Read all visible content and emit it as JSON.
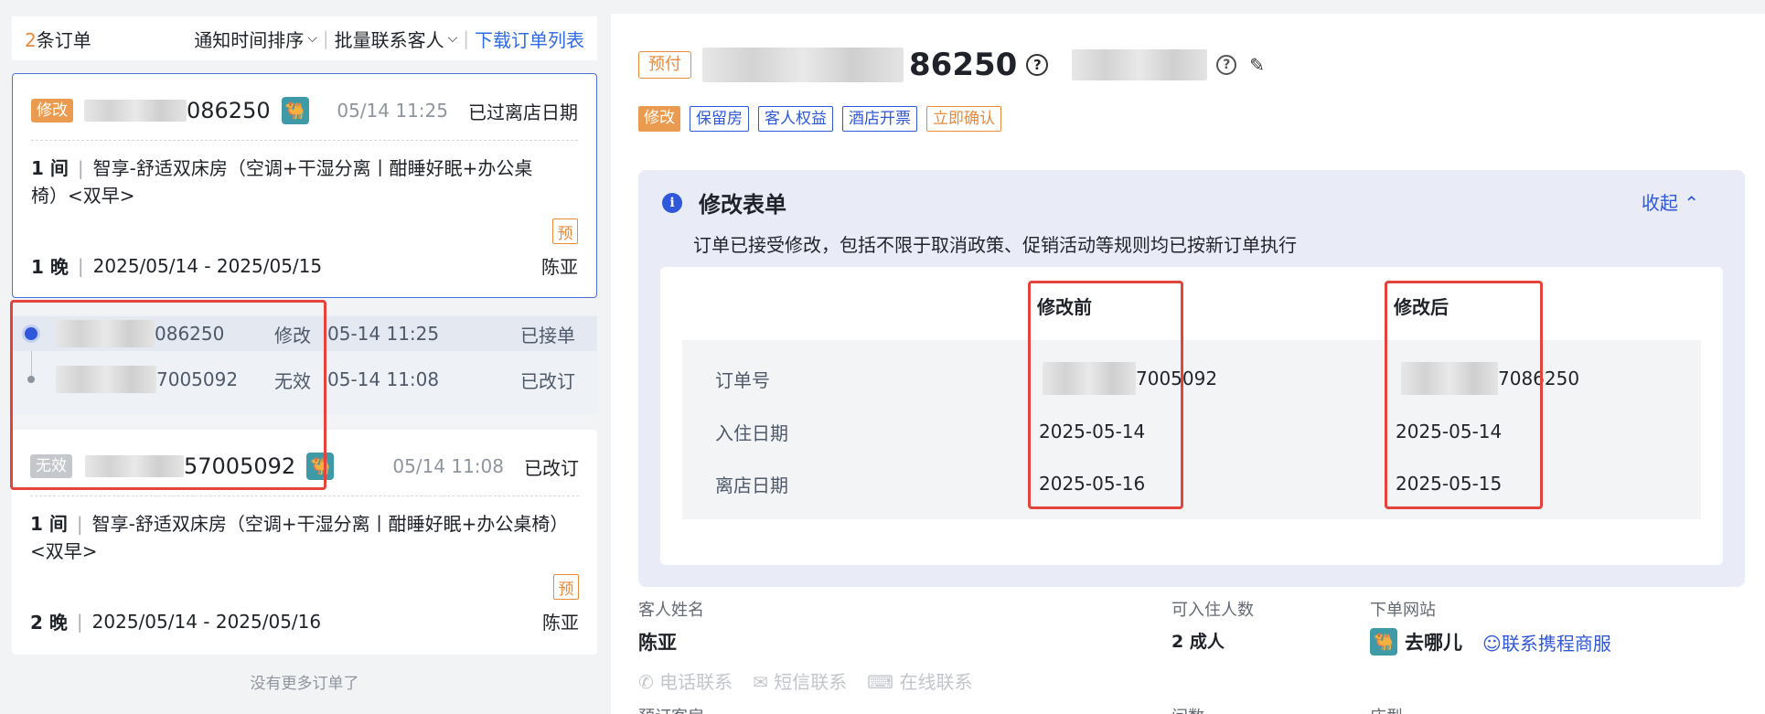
{
  "left": {
    "count_num": "2",
    "count_suffix": "条订单",
    "sort_label": "通知时间排序",
    "batch_label": "批量联系客人",
    "download_label": "下载订单列表",
    "no_more": "没有更多订单了"
  },
  "orders": [
    {
      "tag": "修改",
      "order_no_suffix": "086250",
      "time": "05/14 11:25",
      "status": "已过离店日期",
      "room_count": "1 间",
      "room_name": "智享-舒适双床房（空调+干湿分离丨酣睡好眠+办公桌椅）<双早>",
      "prepay_badge": "预",
      "nights": "1 晚",
      "dates": "2025/05/14 - 2025/05/15",
      "guest": "陈亚"
    },
    {
      "tag": "无效",
      "order_no_suffix": "57005092",
      "time": "05/14 11:08",
      "status": "已改订",
      "room_count": "1 间",
      "room_name": "智享-舒适双床房（空调+干湿分离丨酣睡好眠+办公桌椅）<双早>",
      "prepay_badge": "预",
      "nights": "2 晚",
      "dates": "2025/05/14 - 2025/05/16",
      "guest": "陈亚"
    }
  ],
  "history": [
    {
      "no_suffix": "086250",
      "kind": "修改",
      "time": "05-14 11:25",
      "status": "已接单"
    },
    {
      "no_suffix": "7005092",
      "kind": "无效",
      "time": "05-14 11:08",
      "status": "已改订"
    }
  ],
  "detail": {
    "prepay_tag": "预付",
    "order_no_suffix": "86250",
    "tags": [
      "修改",
      "保留房",
      "客人权益",
      "酒店开票",
      "立即确认"
    ],
    "modify": {
      "title": "修改表单",
      "collapse_label": "收起",
      "desc": "订单已接受修改，包括不限于取消政策、促销活动等规则均已按新订单执行",
      "col_before": "修改前",
      "col_after": "修改后",
      "rows": [
        {
          "label": "订单号",
          "before": "7005092",
          "after": "7086250"
        },
        {
          "label": "入住日期",
          "before": "2025-05-14",
          "after": "2025-05-14"
        },
        {
          "label": "离店日期",
          "before": "2025-05-16",
          "after": "2025-05-15"
        }
      ]
    },
    "guest_name_label": "客人姓名",
    "guest_name": "陈亚",
    "capacity_label": "可入住人数",
    "capacity": "2 成人",
    "site_label": "下单网站",
    "site_name": "去哪儿",
    "ctrip_label": "联系携程商服",
    "contact_phone": "电话联系",
    "contact_sms": "短信联系",
    "contact_online": "在线联系",
    "cut_labels": [
      "预订客房",
      "间数",
      "床型"
    ]
  },
  "colors": {
    "accent": "#2f57d9",
    "orange": "#e98a3b",
    "highlight_red": "#e5443d"
  },
  "icons": [
    "chevron-down-icon",
    "camel-icon",
    "help-icon",
    "edit-icon",
    "info-icon",
    "chevron-up-icon",
    "person-icon",
    "phone-icon",
    "sms-icon",
    "chat-icon"
  ]
}
